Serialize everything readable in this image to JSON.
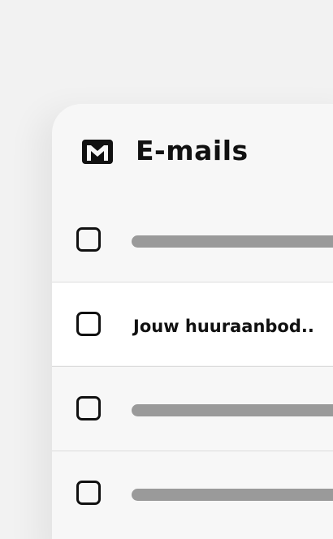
{
  "panel": {
    "title": "E-mails",
    "icon": "mail-icon"
  },
  "emails": [
    {
      "state": "placeholder",
      "subject": ""
    },
    {
      "state": "selected",
      "subject": "Jouw huuraanbod.."
    },
    {
      "state": "placeholder",
      "subject": ""
    },
    {
      "state": "placeholder",
      "subject": ""
    }
  ],
  "colors": {
    "page_background": "#f2f2f2",
    "card_background": "#f7f7f7",
    "selected_row": "#ffffff",
    "placeholder_bar": "#9a9a9a",
    "text": "#111111"
  }
}
